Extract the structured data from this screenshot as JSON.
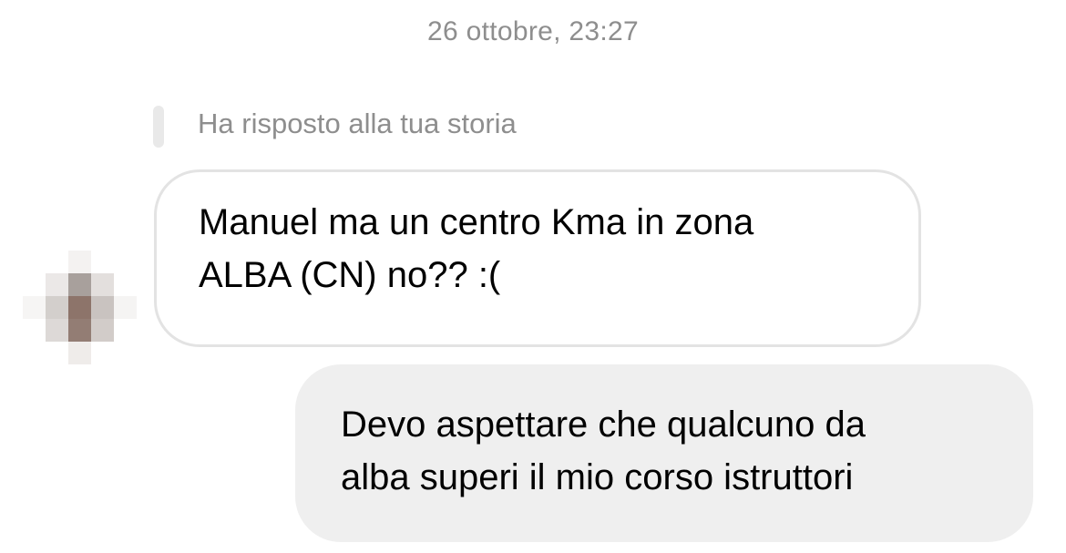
{
  "conversation": {
    "timestamp": "26 ottobre, 23:27",
    "story_reply_label": "Ha risposto alla tua storia",
    "messages": [
      {
        "direction": "received",
        "text": "Manuel ma un centro Kma in zona\nALBA (CN) no?? :("
      },
      {
        "direction": "sent",
        "text": "Devo aspettare che qualcuno da\nalba superi il mio corso istruttori"
      }
    ]
  },
  "sender": {
    "avatar": "pixelated-avatar"
  },
  "colors": {
    "received_bubble_border": "#e3e3e3",
    "sent_bubble_background": "#efefef",
    "meta_text": "#8e8e8e"
  }
}
